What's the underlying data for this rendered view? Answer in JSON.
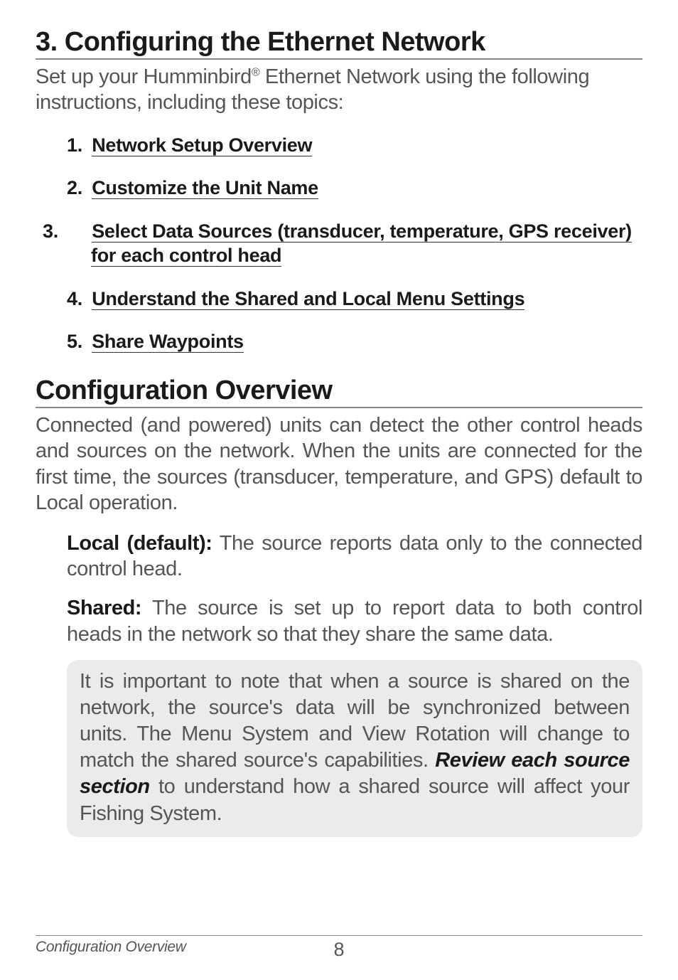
{
  "section1": {
    "heading": "3. Configuring the Ethernet Network",
    "intro_pre": "Set up your Humminbird",
    "intro_sup": "®",
    "intro_post": " Ethernet Network using the following instructions, including these topics:",
    "items": [
      {
        "num": "1.",
        "text": "Network Setup Overview"
      },
      {
        "num": "2.",
        "text": "Customize the Unit Name"
      },
      {
        "num": "3.",
        "line1": "Select Data Sources (transducer, temperature, GPS receiver)",
        "line2": "for each control head"
      },
      {
        "num": "4.",
        "text": "Understand the Shared and Local Menu Settings"
      },
      {
        "num": "5.",
        "text": "Share Waypoints"
      }
    ]
  },
  "section2": {
    "heading": "Configuration Overview",
    "para1": "Connected (and powered) units can detect the other control heads and sources on the network. When the units are connected for the first time, the sources (transducer, temperature, and GPS) default to Local operation.",
    "def1_label": "Local (default):",
    "def1_text": " The source reports data only to the connected control head.",
    "def2_label": "Shared:",
    "def2_text": " The source is set up to report data to both control heads in the network so that they share the same data.",
    "note_pre": "It is important to note that when a source is shared on the network, the source's data will be synchronized between units. The Menu System and View Rotation will change to match the shared source's capabilities. ",
    "note_bold": "Review each source section",
    "note_post": " to understand how a shared source will affect your Fishing System."
  },
  "footer": {
    "left": "Configuration Overview",
    "page": "8"
  }
}
